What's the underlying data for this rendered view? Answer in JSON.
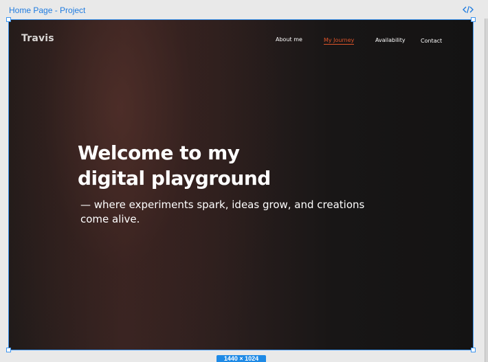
{
  "editor": {
    "frame_label": "Home Page - Project",
    "code_icon": "code-brackets-icon",
    "size_badge": "1440 × 1024",
    "accent_color": "#1e7be0"
  },
  "site": {
    "logo": "Travis",
    "nav": [
      {
        "label": "About me",
        "active": false
      },
      {
        "label": "My Journey",
        "active": true
      },
      {
        "label": "Availability",
        "active": false
      },
      {
        "label": "Contact",
        "active": false
      }
    ],
    "active_color": "#e0552a",
    "hero": {
      "title_line1": "Welcome to my",
      "title_line2": "digital playground",
      "subtitle": "— where experiments spark, ideas grow, and creations come alive."
    }
  }
}
